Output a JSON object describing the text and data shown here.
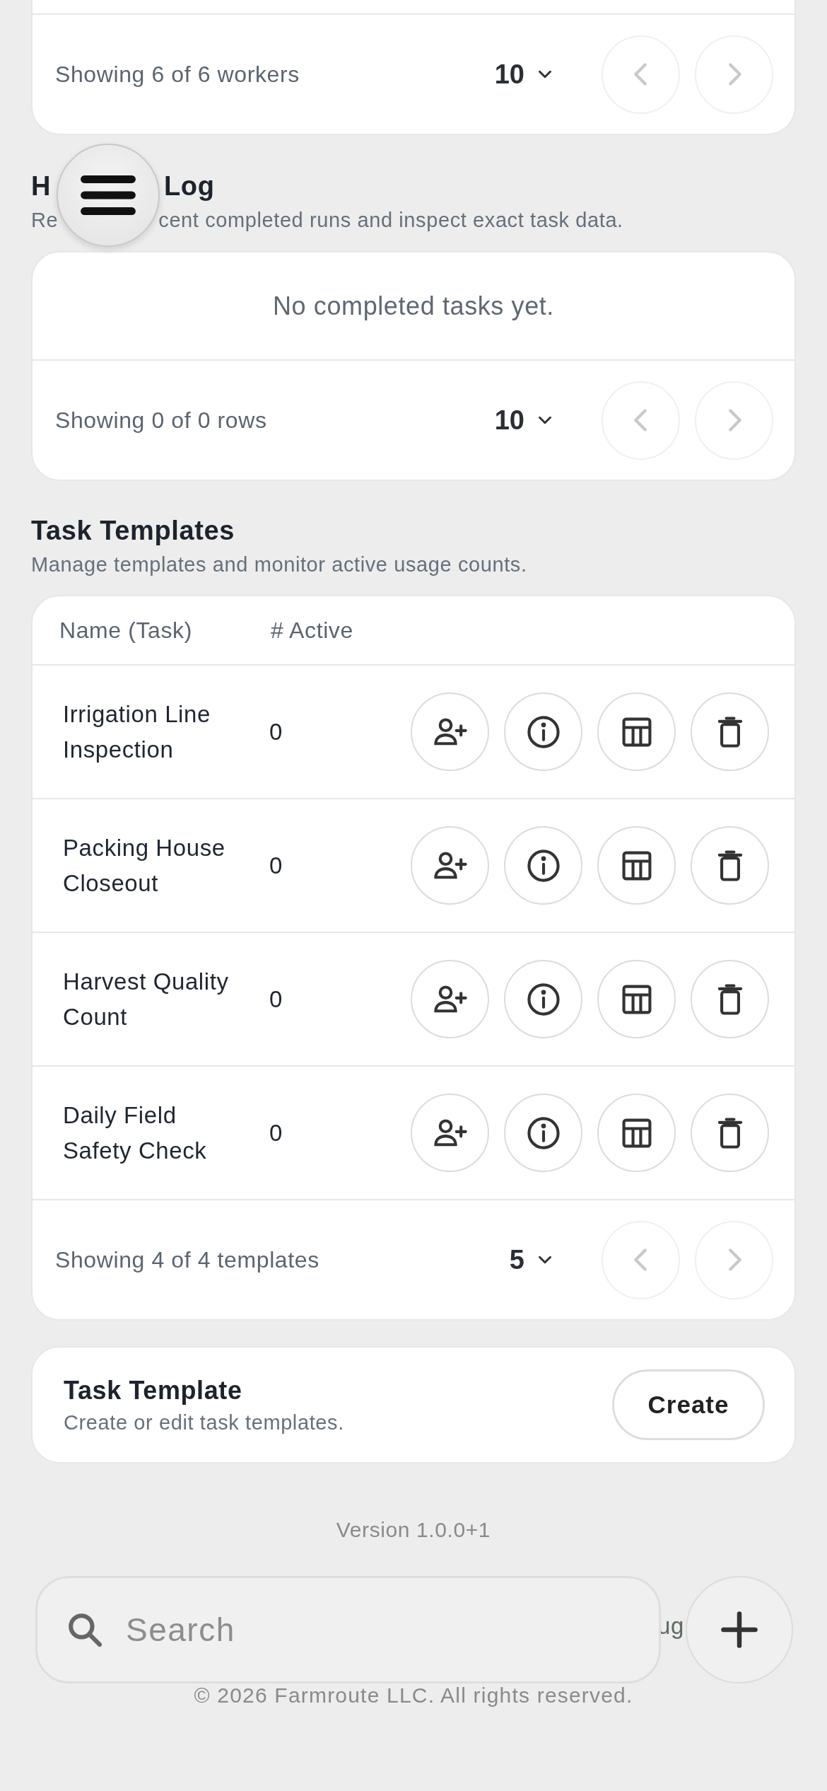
{
  "workers_table": {
    "footer": {
      "summary": "Showing 6 of 6 workers",
      "page_size": "10",
      "prev": {
        "disabled": true
      },
      "next": {
        "disabled": true
      }
    }
  },
  "history": {
    "title_parts": [
      "H",
      "Log"
    ],
    "subtitle_parts": [
      "Re",
      "cent completed runs and inspect exact task data."
    ],
    "empty": "No completed tasks yet.",
    "footer": {
      "summary": "Showing 0 of 0 rows",
      "page_size": "10",
      "prev": {
        "disabled": true
      },
      "next": {
        "disabled": true
      }
    }
  },
  "templates": {
    "title": "Task Templates",
    "subtitle": "Manage templates and monitor active usage counts.",
    "columns": [
      "Name (Task)",
      "# Active"
    ],
    "rows": [
      {
        "name": "Irrigation Line Inspection",
        "active": "0"
      },
      {
        "name": "Packing House Closeout",
        "active": "0"
      },
      {
        "name": "Harvest Quality Count",
        "active": "0"
      },
      {
        "name": "Daily Field Safety Check",
        "active": "0"
      }
    ],
    "footer": {
      "summary": "Showing 4 of 4 templates",
      "page_size": "5",
      "prev": {
        "disabled": true
      },
      "next": {
        "disabled": true
      }
    }
  },
  "editor": {
    "title": "Task Template",
    "subtitle": "Create or edit task templates.",
    "button": "Create"
  },
  "version": "Version 1.0.0+1",
  "bottom_bar": {
    "search": {
      "placeholder": "Search"
    },
    "behind_text": "ug"
  },
  "copyright": "© 2026 Farmroute LLC. All rights reserved."
}
